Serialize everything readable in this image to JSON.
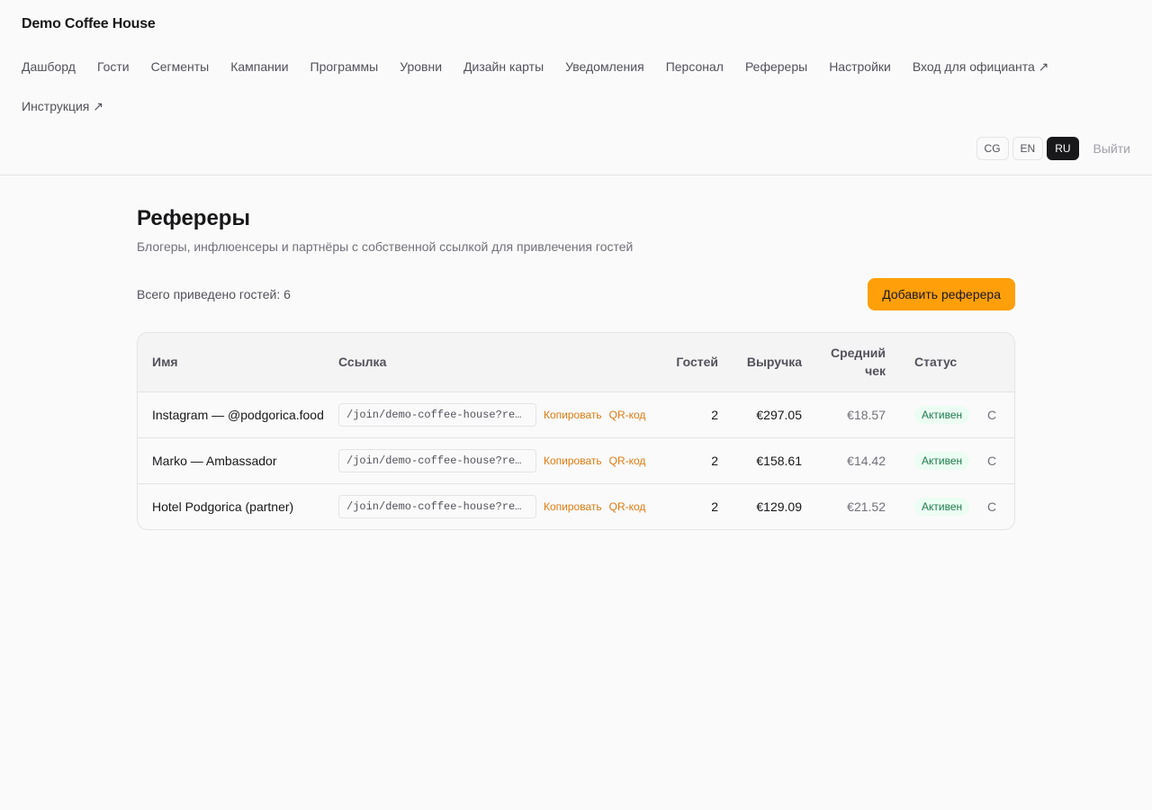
{
  "app": {
    "brand": "Demo Coffee House"
  },
  "nav": [
    "Дашборд",
    "Гости",
    "Сегменты",
    "Кампании",
    "Программы",
    "Уровни",
    "Дизайн карты",
    "Уведомления",
    "Персонал",
    "Рефереры",
    "Настройки",
    "Вход для официанта ↗",
    "Инструкция ↗"
  ],
  "languages": [
    "CG",
    "EN",
    "RU"
  ],
  "active_language": "RU",
  "logout_label": "Выйти",
  "page": {
    "title": "Рефереры",
    "subtitle": "Блогеры, инфлюенсеры и партнёры с собственной ссылкой для привлечения гостей",
    "summary": "Всего приведено гостей: 6",
    "add_button": "Добавить реферера"
  },
  "table": {
    "headers": {
      "name": "Имя",
      "link": "Ссылка",
      "guests": "Гостей",
      "revenue": "Выручка",
      "avg_line1": "Средний",
      "avg_line2": "чек",
      "status": "Статус"
    },
    "copy_label": "Копировать",
    "qr_label": "QR-код",
    "rows": [
      {
        "name": "Instagram — @podgorica.food",
        "link": "/join/demo-coffee-house?re…",
        "guests": "2",
        "revenue": "€297.05",
        "avg": "€18.57",
        "status": "Активен",
        "extra": "С"
      },
      {
        "name": "Marko — Ambassador",
        "link": "/join/demo-coffee-house?re…",
        "guests": "2",
        "revenue": "€158.61",
        "avg": "€14.42",
        "status": "Активен",
        "extra": "С"
      },
      {
        "name": "Hotel Podgorica (partner)",
        "link": "/join/demo-coffee-house?re…",
        "guests": "2",
        "revenue": "€129.09",
        "avg": "€21.52",
        "status": "Активен",
        "extra": "С"
      }
    ]
  },
  "colors": {
    "accent": "#ff9f0a",
    "link_action": "#e07b12",
    "status_bg": "#ecfdf3",
    "status_text": "#1f7a4d",
    "active_lang_bg": "#18181b"
  }
}
